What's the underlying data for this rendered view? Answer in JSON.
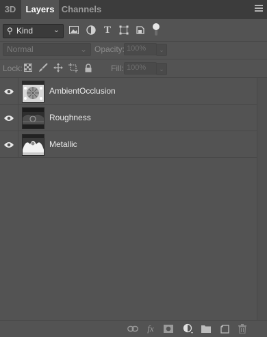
{
  "tabs": [
    {
      "label": "3D"
    },
    {
      "label": "Layers"
    },
    {
      "label": "Channels"
    }
  ],
  "active_tab": "Layers",
  "filter": {
    "kind_label": "Kind",
    "icons": [
      "image-filter-icon",
      "adjustment-filter-icon",
      "type-filter-icon",
      "shape-filter-icon",
      "smart-object-filter-icon"
    ]
  },
  "blend": {
    "mode": "Normal",
    "opacity_label": "Opacity:",
    "opacity_value": "100%"
  },
  "locks": {
    "label": "Lock:",
    "fill_label": "Fill:",
    "fill_value": "100%"
  },
  "layers": [
    {
      "name": "AmbientOcclusion",
      "visible": true
    },
    {
      "name": "Roughness",
      "visible": true
    },
    {
      "name": "Metallic",
      "visible": true
    }
  ],
  "footer_icons": [
    "link-layers-icon",
    "fx-icon",
    "add-mask-icon",
    "adjustment-layer-icon",
    "new-group-icon",
    "new-layer-icon",
    "delete-layer-icon"
  ],
  "colors": {
    "panel": "#535353",
    "tabbar": "#3c3c3c",
    "text": "#ececec"
  }
}
